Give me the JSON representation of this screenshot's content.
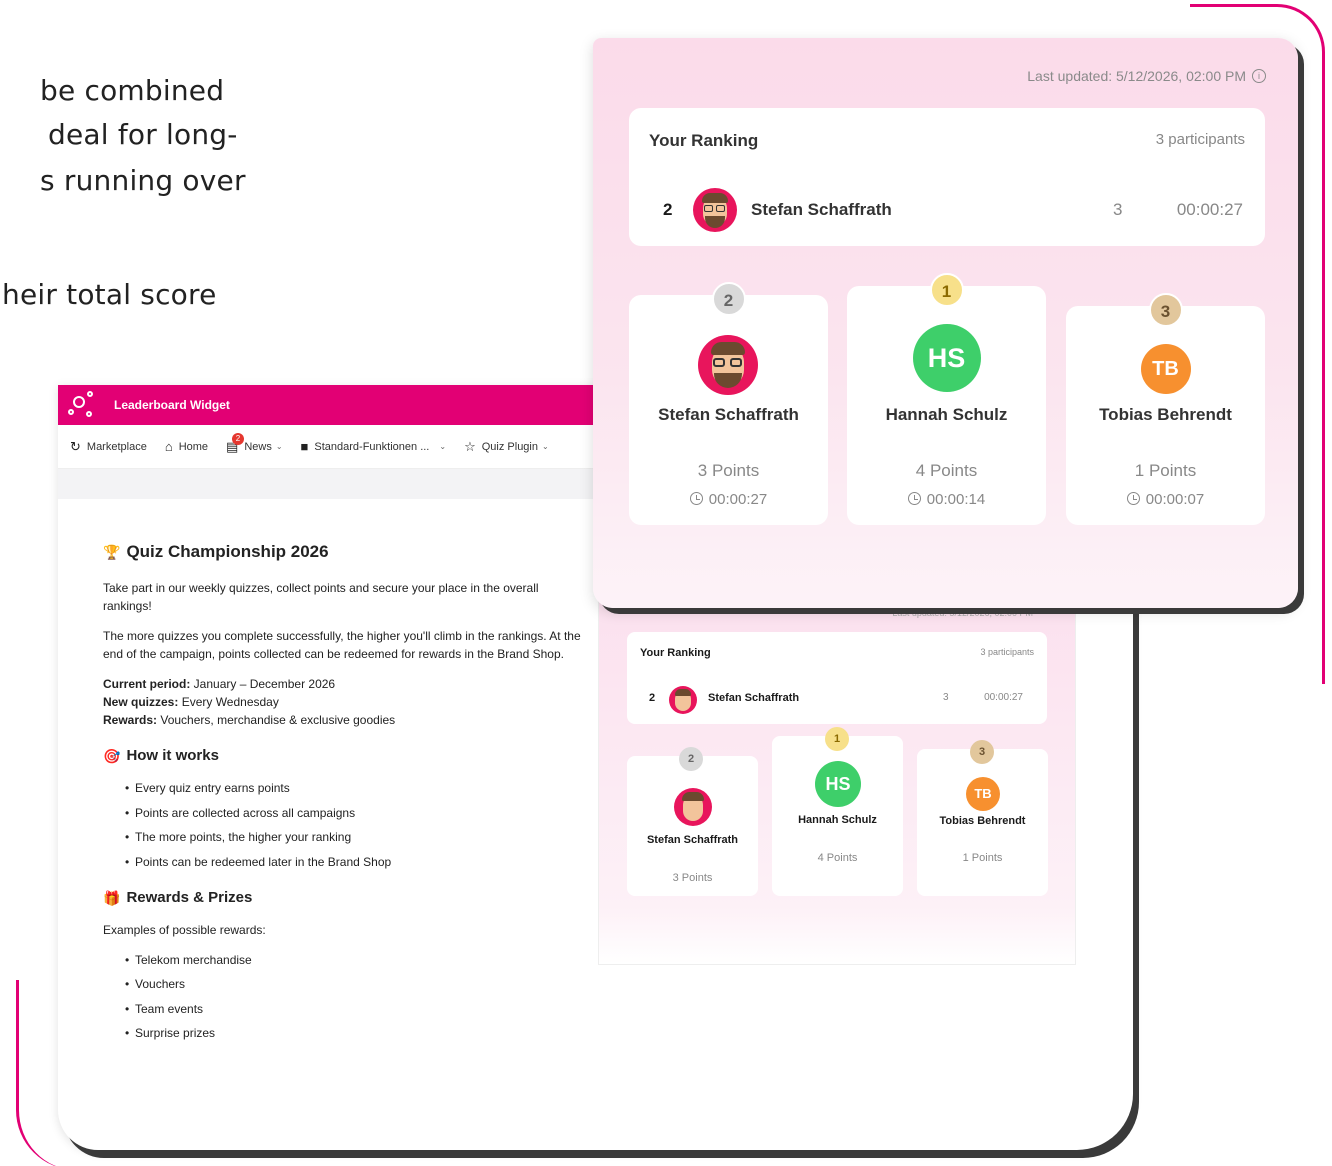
{
  "background_text": {
    "line1": "be combined",
    "line2": "deal for long-",
    "line3": "s running over",
    "line4": "heir total score"
  },
  "app": {
    "title": "Leaderboard Widget",
    "nav": [
      {
        "label": "Marketplace",
        "icon": "refresh-icon"
      },
      {
        "label": "Home",
        "icon": "home-icon"
      },
      {
        "label": "News",
        "icon": "news-icon",
        "badge": "2"
      },
      {
        "label": "Standard-Funktionen ...",
        "icon": "folder-icon"
      },
      {
        "label": "Quiz Plugin",
        "icon": "star-icon"
      }
    ]
  },
  "article": {
    "title": "Quiz Championship 2026",
    "p1": "Take part in our weekly quizzes, collect points and secure your place in the overall rankings!",
    "p2": "The more quizzes you complete successfully, the higher you'll climb in the rankings. At the end of the campaign, points collected can be redeemed for rewards in the Brand Shop.",
    "period_label": "Current period:",
    "period_value": " January – December 2026",
    "new_label": "New quizzes:",
    "new_value": " Every Wednesday",
    "rewards_label": "Rewards:",
    "rewards_value": " Vouchers, merchandise & exclusive goodies",
    "how_title": "How it works",
    "how_items": [
      "Every quiz entry earns points",
      "Points are collected across all campaigns",
      "The more points, the higher your ranking",
      "Points can be redeemed later in the Brand Shop"
    ],
    "rewards_title": "Rewards & Prizes",
    "rewards_intro": "Examples of possible rewards:",
    "rewards_items": [
      "Telekom merchandise",
      "Vouchers",
      "Team events",
      "Surprise prizes"
    ]
  },
  "leaderboard": {
    "updated": "Last updated: 5/12/2026, 02:00 PM",
    "ranking_title": "Your Ranking",
    "participants": "3 participants",
    "me": {
      "position": "2",
      "name": "Stefan Schaffrath",
      "score": "3",
      "time": "00:00:27"
    },
    "podium": [
      {
        "rank": "2",
        "name": "Stefan Schaffrath",
        "points": "3 Points",
        "time": "00:00:27",
        "avatar": "memoji"
      },
      {
        "rank": "1",
        "name": "Hannah Schulz",
        "points": "4 Points",
        "time": "00:00:14",
        "initials": "HS",
        "color": "#3ecf6a"
      },
      {
        "rank": "3",
        "name": "Tobias Behrendt",
        "points": "1 Points",
        "time": "00:00:07",
        "initials": "TB",
        "color": "#f7902f"
      }
    ],
    "badge_colors": {
      "first": "#f7e08a",
      "second": "#d9d9d9",
      "third": "#e2c79c"
    }
  }
}
